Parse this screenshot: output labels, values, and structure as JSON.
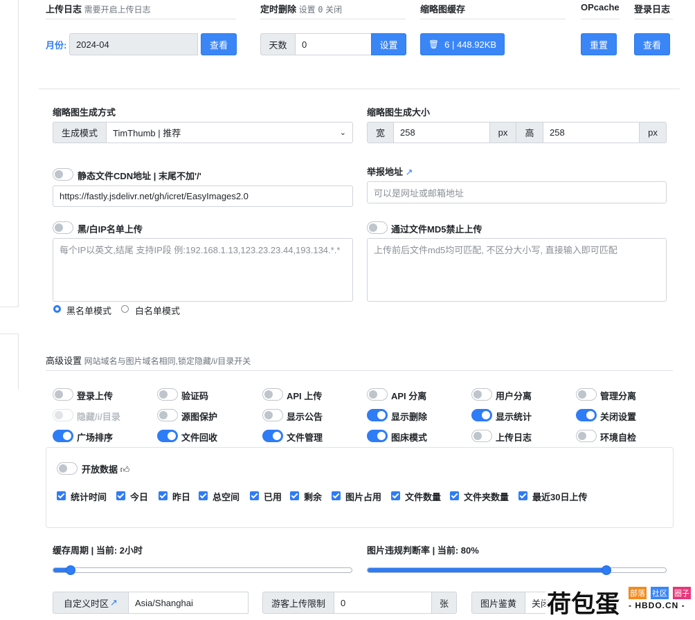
{
  "top": {
    "upload_log": {
      "title": "上传日志",
      "hint": "需要开启上传日志",
      "month_label": "月份:",
      "month_value": "2024-04",
      "view_btn": "查看"
    },
    "scheduled_delete": {
      "title": "定时删除",
      "hint_prefix": "设置",
      "hint_value": "0",
      "hint_suffix": "关闭",
      "days_label": "天数",
      "days_value": "0",
      "set_btn": "设置"
    },
    "thumb_cache": {
      "title": "缩略图缓存",
      "btn": "6 | 448.92KB"
    },
    "opcache": {
      "title": "OPcache",
      "btn": "重置"
    },
    "login_log": {
      "title": "登录日志",
      "btn": "查看"
    }
  },
  "thumbnail": {
    "method_title": "缩略图生成方式",
    "mode_label": "生成模式",
    "mode_value": "TimThumb | 推荐",
    "size_title": "缩略图生成大小",
    "width_label": "宽",
    "width_value": "258",
    "px1": "px",
    "height_label": "高",
    "height_value": "258",
    "px2": "px"
  },
  "cdn": {
    "label": "静态文件CDN地址 | 末尾不加'/'",
    "value": "https://fastly.jsdelivr.net/gh/icret/EasyImages2.0",
    "enabled": false
  },
  "report": {
    "label": "举报地址",
    "placeholder": "可以是网址或邮箱地址"
  },
  "ip_list": {
    "label": "黑/白IP名单上传",
    "placeholder": "每个IP以英文,结尾 支持IP段 例:192.168.1.13,123.23.23.44,193.134.*.*",
    "enabled": false,
    "radio_black": "黑名单模式",
    "radio_white": "白名单模式"
  },
  "md5": {
    "label": "通过文件MD5禁止上传",
    "placeholder": "上传前后文件md5均可匹配, 不区分大小写, 直接输入即可匹配",
    "enabled": false
  },
  "advanced": {
    "title": "高级设置",
    "hint": "网站域名与图片域名相同,锁定隐藏/i/目录开关",
    "toggles": [
      {
        "label": "登录上传",
        "on": false,
        "disabled": false
      },
      {
        "label": "验证码",
        "on": false,
        "disabled": false
      },
      {
        "label": "API 上传",
        "on": false,
        "disabled": false
      },
      {
        "label": "API 分离",
        "on": false,
        "disabled": false
      },
      {
        "label": "用户分离",
        "on": false,
        "disabled": false
      },
      {
        "label": "管理分离",
        "on": false,
        "disabled": false
      },
      {
        "label": "隐藏/i/目录",
        "on": false,
        "disabled": true
      },
      {
        "label": "源图保护",
        "on": false,
        "disabled": false
      },
      {
        "label": "显示公告",
        "on": false,
        "disabled": false
      },
      {
        "label": "显示删除",
        "on": true,
        "disabled": false
      },
      {
        "label": "显示统计",
        "on": true,
        "disabled": false
      },
      {
        "label": "关闭设置",
        "on": true,
        "disabled": false
      },
      {
        "label": "广场排序",
        "on": true,
        "disabled": false
      },
      {
        "label": "文件回收",
        "on": true,
        "disabled": false
      },
      {
        "label": "文件管理",
        "on": true,
        "disabled": false
      },
      {
        "label": "图床模式",
        "on": true,
        "disabled": false
      },
      {
        "label": "上传日志",
        "on": false,
        "disabled": false
      },
      {
        "label": "环境自检",
        "on": false,
        "disabled": false
      }
    ]
  },
  "open_data": {
    "label": "开放数据",
    "checks": [
      "统计时间",
      "今日",
      "昨日",
      "总空间",
      "已用",
      "剩余",
      "图片占用",
      "文件数量",
      "文件夹数量",
      "最近30日上传"
    ]
  },
  "cache_period": {
    "label": "缓存周期 | 当前: 2小时",
    "value_fraction": 0.06
  },
  "violation": {
    "label": "图片违规判断率 | 当前: 80%",
    "value_fraction": 0.8
  },
  "bottom": {
    "timezone_label": "自定义时区",
    "timezone_value": "Asia/Shanghai",
    "guest_label": "游客上传限制",
    "guest_value": "0",
    "guest_unit": "张",
    "review_label": "图片鉴黄",
    "review_value": "关闭"
  },
  "watermark": {
    "brand": "荷包蛋",
    "tag1": "部落",
    "tag2": "社区",
    "tag3": "圈子",
    "domain": "HBDO.CN"
  },
  "colors": {
    "primary": "#3a86f7",
    "toggle_on": "#2e7cf6"
  }
}
